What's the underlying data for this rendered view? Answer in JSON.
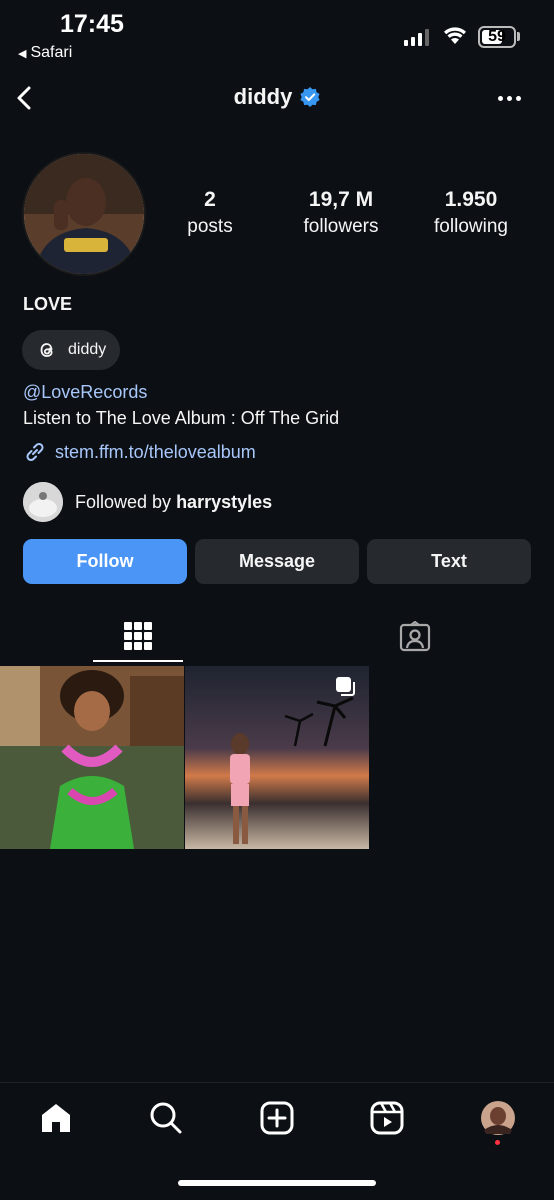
{
  "status_bar": {
    "time": "17:45",
    "back_app": "Safari",
    "battery": "59"
  },
  "header": {
    "username": "diddy"
  },
  "profile": {
    "stats": [
      {
        "value": "2",
        "label": "posts"
      },
      {
        "value": "19,7 M",
        "label": "followers"
      },
      {
        "value": "1.950",
        "label": "following"
      }
    ],
    "full_name": "LOVE",
    "threads_handle": "diddy",
    "bio_mention": "@LoveRecords",
    "bio_text": "Listen to The Love Album : Off The Grid",
    "link": "stem.ffm.to/thelovealbum",
    "followed_by_prefix": "Followed by",
    "followed_by_user": "harrystyles"
  },
  "buttons": {
    "follow": "Follow",
    "message": "Message",
    "text": "Text"
  },
  "tabs": [
    "grid-icon",
    "tagged-icon"
  ],
  "bottom_nav": [
    "home-icon",
    "search-icon",
    "create-icon",
    "reels-icon",
    "profile-avatar"
  ],
  "colors": {
    "background": "#0c1014",
    "accent": "#4a95f5",
    "link": "#a8c7fa",
    "button": "#262a2e"
  }
}
